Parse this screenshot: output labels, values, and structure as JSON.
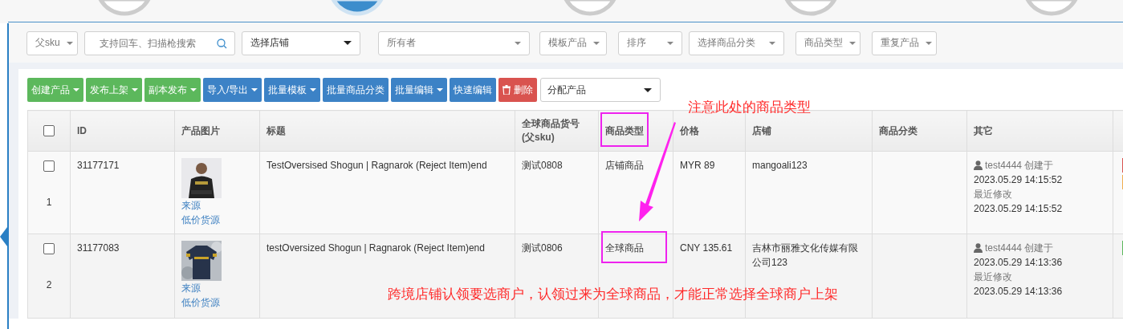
{
  "steps": [
    {
      "selected": false
    },
    {
      "selected": true
    },
    {
      "selected": false
    },
    {
      "selected": false
    },
    {
      "selected": false
    }
  ],
  "filters": [
    {
      "kind": "select",
      "label": "父sku"
    },
    {
      "kind": "search",
      "placeholder": "支持回车、扫描枪搜索"
    },
    {
      "kind": "select",
      "label": "选择店铺",
      "strong": true
    },
    {
      "kind": "select",
      "label": "所有者"
    },
    {
      "kind": "select",
      "label": "模板产品"
    },
    {
      "kind": "select",
      "label": "排序"
    },
    {
      "kind": "select",
      "label": "选择商品分类"
    },
    {
      "kind": "select",
      "label": "商品类型"
    },
    {
      "kind": "select",
      "label": "重复产品"
    }
  ],
  "toolbar": [
    {
      "label": "创建产品",
      "kind": "green",
      "caret": true
    },
    {
      "label": "发布上架",
      "kind": "green",
      "caret": true
    },
    {
      "label": "副本发布",
      "kind": "green",
      "caret": true
    },
    {
      "label": "导入/导出",
      "kind": "blue",
      "caret": true
    },
    {
      "label": "批量模板",
      "kind": "blue",
      "caret": true
    },
    {
      "label": "批量商品分类",
      "kind": "blue",
      "caret": false
    },
    {
      "label": "批量编辑",
      "kind": "blue",
      "caret": true
    },
    {
      "label": "快速编辑",
      "kind": "blue",
      "caret": false
    },
    {
      "label": "删除",
      "kind": "red",
      "caret": false
    }
  ],
  "assign_select": {
    "label": "分配产品"
  },
  "table": {
    "select_all": {
      "checked": false
    },
    "columns": [
      "ID",
      "产品图片",
      "标题",
      "全球商品货号\n(父sku)",
      "商品类型",
      "价格",
      "店铺",
      "商品分类",
      "其它"
    ],
    "rows": [
      {
        "checked": false,
        "index": "1",
        "id": "31177171",
        "picture": {
          "kind": "picture"
        },
        "links": [
          "来源",
          "低价货源"
        ],
        "title": "TestOversised Shogun | Ragnarok (Reject Item)end",
        "sku": "测试0808",
        "type": "店铺商品",
        "price": "MYR 89",
        "shop": "mangoali123",
        "user": "test4444",
        "created_label": "创建于",
        "created": "2023.05.29 14:15:52",
        "modified_label": "最近修改",
        "modified": "2023.05.29 14:15:52",
        "tags": [
          {
            "color": "#d9534f"
          },
          {
            "color": "#f0ad4e"
          }
        ]
      },
      {
        "checked": false,
        "index": "2",
        "id": "31177083",
        "picture": {
          "kind": "picture"
        },
        "links": [
          "来源",
          "低价货源"
        ],
        "title": "testOversized Shogun | Ragnarok (Reject Item)end",
        "sku": "测试0806",
        "type": "全球商品",
        "price": "CNY 135.61",
        "shop": "吉林市丽雅文化传媒有限公司123",
        "user": "test4444",
        "created_label": "创建于",
        "created": "2023.05.29 14:13:36",
        "modified_label": "最近修改",
        "modified": "2023.05.29 14:13:36",
        "tags": [
          {
            "color": "#5cb85c"
          }
        ]
      }
    ]
  },
  "annotations": {
    "note_top": "注意此处的商品类型",
    "note_bottom": "跨境店铺认领要选商户，认领过来为全球商品，才能正常选择全球商户上架"
  }
}
